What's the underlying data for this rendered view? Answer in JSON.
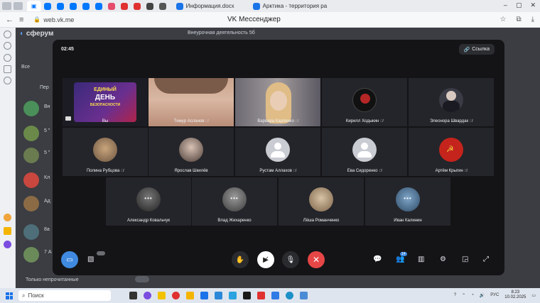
{
  "browser": {
    "tabs": [
      "Информация.docx",
      "Арктика - территория ра"
    ],
    "url": "web.vk.me",
    "page_title": "VK Мессенджер"
  },
  "vk": {
    "brand": "сферум",
    "chat_title": "Внеурочная деятельность 5б",
    "list_fragments": [
      "Все",
      "Пер",
      "Вн",
      "5 \"",
      "5 \"",
      "Кл",
      "Ад",
      "8а",
      "7 А"
    ],
    "unread_label": "Только непрочитанные"
  },
  "call": {
    "timer": "02:45",
    "link_label": "Ссылка",
    "participants": [
      {
        "name": "Вы",
        "kind": "banner",
        "banner_lines": [
          "ЕДИНЫЙ",
          "ДЕНЬ",
          "БЕЗОПАСНОСТИ"
        ],
        "muted": false
      },
      {
        "name": "Тимур Асланов",
        "kind": "photo",
        "muted": true
      },
      {
        "name": "Варвара Карпенко",
        "kind": "photo",
        "muted": true
      },
      {
        "name": "Кирилл Ходыкин",
        "kind": "avatar",
        "muted": true
      },
      {
        "name": "Элеонора Швардак",
        "kind": "avatar",
        "muted": true
      },
      {
        "name": "Полина Рубцова",
        "kind": "avatar",
        "muted": true
      },
      {
        "name": "Ярослав Шкилёв",
        "kind": "avatar",
        "muted": false
      },
      {
        "name": "Рустам Аллахов",
        "kind": "placeholder",
        "muted": true
      },
      {
        "name": "Ева Сидоренко",
        "kind": "placeholder",
        "muted": true
      },
      {
        "name": "Артём Крыгин",
        "kind": "avatar",
        "muted": true
      },
      {
        "name": "Александр Ковальчук",
        "kind": "avatar",
        "muted": false
      },
      {
        "name": "Влад Жихаренко",
        "kind": "avatar",
        "muted": false
      },
      {
        "name": "Лёша Романченко",
        "kind": "avatar",
        "muted": false
      },
      {
        "name": "Иван Калинин",
        "kind": "avatar",
        "muted": false
      }
    ],
    "people_count": "14",
    "colors": {
      "end_call": "#e64646",
      "accent": "#3f8ae0",
      "tile_bg": "#24252a"
    }
  },
  "taskbar": {
    "search_placeholder": "Поиск",
    "lang": "РУС",
    "time": "8:23",
    "date": "10.02.2025"
  }
}
